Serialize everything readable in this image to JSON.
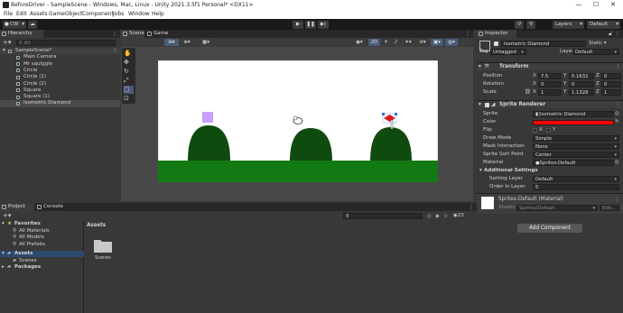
{
  "window": {
    "title": "BeforeDriver - SampleScene - Windows, Mac, Linux - Unity 2021.3.5f1 Personal* <DX11>",
    "min": "—",
    "max": "☐",
    "close": "✕"
  },
  "menu": [
    "File",
    "Edit",
    "Assets",
    "GameObject",
    "Component",
    "Jobs",
    "Window",
    "Help"
  ],
  "toolbar": {
    "account": "CW",
    "layers": "Layers",
    "layout": "Default"
  },
  "hierarchy": {
    "tab": "Hierarchy",
    "search_placeholder": "All",
    "scene": "SampleScene*",
    "items": [
      "Main Camera",
      "Mr squiggle",
      "Circle",
      "Circle (1)",
      "Circle (2)",
      "Square",
      "Square (1)",
      "Isometric Diamond"
    ],
    "selected_index": 7
  },
  "scene_view": {
    "tabs": [
      "Scene",
      "Game"
    ],
    "mode_2d": "2D",
    "colors": {
      "sky": "#ffffff",
      "ground": "#137a13",
      "hill": "#0f4a0f",
      "square": "#c8a0ff",
      "diamond": "#dd1a1a"
    }
  },
  "inspector": {
    "tab": "Inspector",
    "object_name": "Isometric Diamond",
    "static": "Static",
    "tag_label": "Tag",
    "tag_value": "Untagged",
    "layer_label": "Layer",
    "layer_value": "Default",
    "transform": {
      "title": "Transform",
      "position_label": "Position",
      "position": {
        "x": "7.5",
        "y": "0.1632",
        "z": "0"
      },
      "rotation_label": "Rotation",
      "rotation": {
        "x": "0",
        "y": "0",
        "z": "0"
      },
      "scale_label": "Scale",
      "scale": {
        "x": "1",
        "y": "1.1328",
        "z": "1"
      }
    },
    "sprite_renderer": {
      "title": "Sprite Renderer",
      "sprite_label": "Sprite",
      "sprite_value": "Isometric Diamond",
      "color_label": "Color",
      "color_value": "#ff0000",
      "flip_label": "Flip",
      "flip_x": "X",
      "flip_y": "Y",
      "draw_mode_label": "Draw Mode",
      "draw_mode_value": "Simple",
      "mask_label": "Mask Interaction",
      "mask_value": "None",
      "sort_point_label": "Sprite Sort Point",
      "sort_point_value": "Center",
      "material_label": "Material",
      "material_value": "Sprites-Default",
      "additional": "Additional Settings",
      "sorting_layer_label": "Sorting Layer",
      "sorting_layer_value": "Default",
      "order_label": "Order in Layer",
      "order_value": "5"
    },
    "material_section": {
      "title": "Sprites-Default (Material)",
      "shader_label": "Shader",
      "shader_value": "Sprites/Default",
      "edit": "Edit..."
    },
    "add_component": "Add Component"
  },
  "project": {
    "tabs": [
      "Project",
      "Console"
    ],
    "favorites": "Favorites",
    "favorite_items": [
      "All Materials",
      "All Models",
      "All Prefabs"
    ],
    "assets_root": "Assets",
    "asset_children": [
      "Scenes"
    ],
    "packages": "Packages",
    "breadcrumb": "Assets",
    "grid_items": [
      "Scenes"
    ],
    "hidden_count": "23"
  }
}
